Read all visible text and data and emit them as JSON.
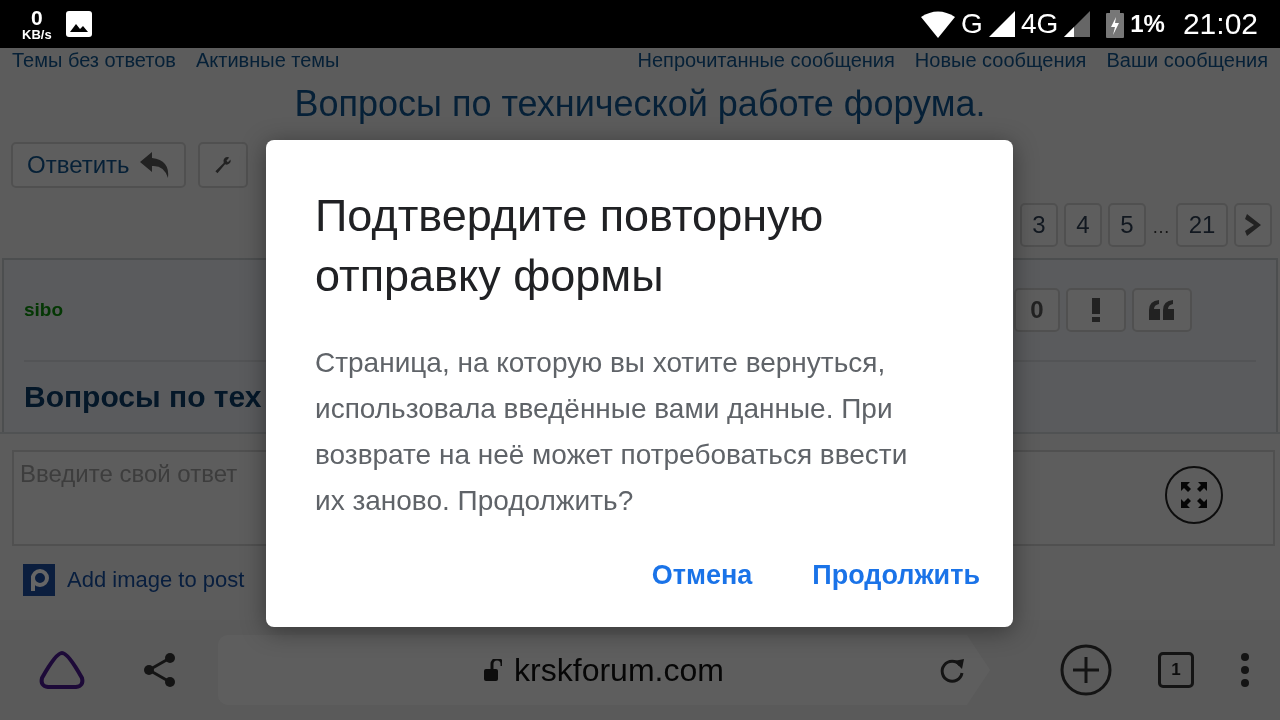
{
  "status_bar": {
    "speed": "0",
    "speed_unit": "KB/s",
    "network_1": "G",
    "network_2": "4G",
    "battery": "1%",
    "time": "21:02"
  },
  "forum": {
    "nav_left": [
      "Темы без ответов",
      "Активные темы"
    ],
    "nav_right": [
      "Непрочитанные сообщения",
      "Новые сообщения",
      "Ваши сообщения"
    ],
    "title": "Вопросы по технической работе форума.",
    "reply_button": "Ответить",
    "pages": [
      "3",
      "4",
      "5"
    ],
    "pages_gap": "…",
    "last_page": "21",
    "post": {
      "author": "sibo",
      "like_count": "0",
      "title": "Вопросы по тех"
    },
    "reply_placeholder": "Введите свой ответ",
    "add_image": "Add image to post"
  },
  "dialog": {
    "title": "Подтвердите повторную отправку формы",
    "message": "Страница, на которую вы хотите вернуться, использовала введённые вами данные. При возврате на неё может потребоваться ввести их заново. Продолжить?",
    "buttons": [
      "Отмена",
      "Продолжить"
    ]
  },
  "browser_bar": {
    "url": "krskforum.com",
    "tab_count": "1"
  }
}
